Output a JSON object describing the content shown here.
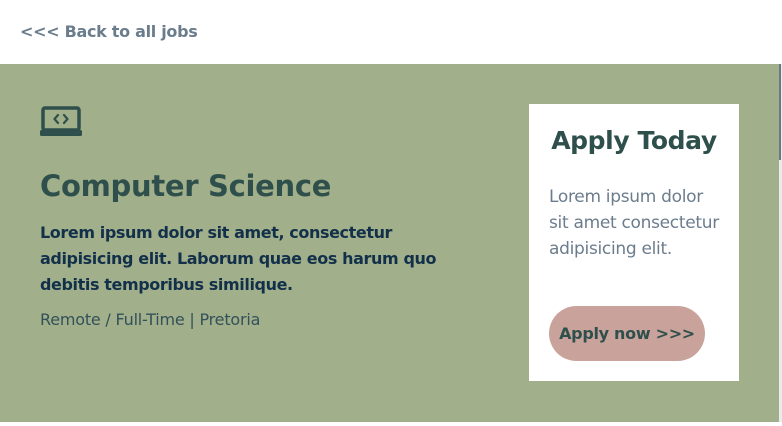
{
  "nav": {
    "back_label": "<<< Back to all jobs"
  },
  "job": {
    "icon": "laptop-code-icon",
    "title": "Computer Science",
    "summary": "Lorem ipsum dolor sit amet, consectetur adipisicing elit. Laborum quae eos harum quo debitis temporibus similique.",
    "meta": "Remote / Full-Time | Pretoria"
  },
  "apply": {
    "heading": "Apply Today",
    "text": "Lorem ipsum dolor sit amet consectetur adipisicing elit.",
    "button_label": "Apply now >>>"
  },
  "colors": {
    "hero_bg": "#a1b08a",
    "heading": "#2e4f4b",
    "button_bg": "#c9a39b",
    "muted_text": "#6b7c8c"
  }
}
